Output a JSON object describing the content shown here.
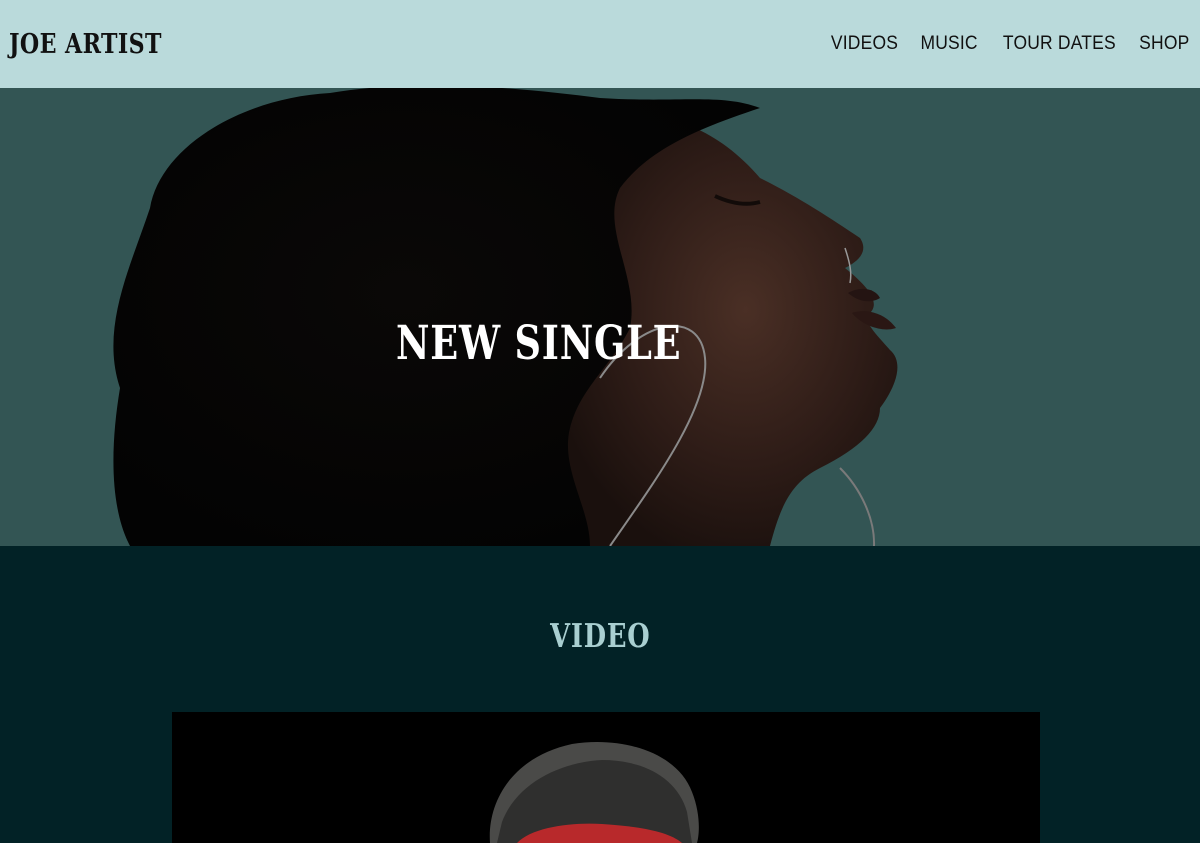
{
  "header": {
    "logo": "JOE ARTIST",
    "nav": [
      {
        "label": "VIDEOS"
      },
      {
        "label": "MUSIC"
      },
      {
        "label": "TOUR DATES"
      },
      {
        "label": "SHOP"
      }
    ]
  },
  "hero": {
    "title": "NEW SINGLE"
  },
  "video_section": {
    "heading": "VIDEO"
  },
  "colors": {
    "header_bg": "#badadb",
    "hero_bg": "#335554",
    "section_bg": "#022226",
    "heading_accent": "#a9cfd1"
  }
}
